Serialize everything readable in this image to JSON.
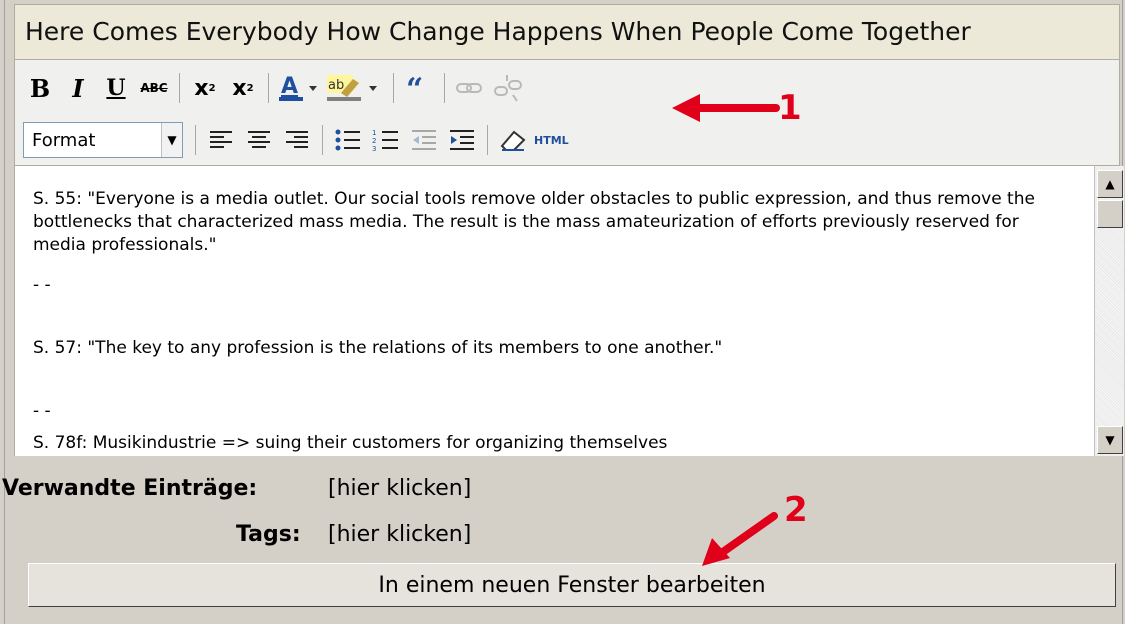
{
  "editor": {
    "title": "Here Comes Everybody How Change Happens When People Come Together",
    "toolbar": {
      "bold": "B",
      "italic": "I",
      "underline": "U",
      "strike": "ABC",
      "subscript": "x",
      "superscript": "x",
      "format_label": "Format",
      "html_label": "HTML"
    },
    "content": [
      "S. 55: \"Everyone is a media outlet. Our social tools remove older obstacles to public expression, and thus remove the bottlenecks that characterized mass media. The result is the mass amateurization of efforts previously reserved for media professionals.\"",
      "- -",
      "S. 57: \"The key to any profession is the relations of its members to one another.\"",
      "- -",
      "S. 78f: Musikindustrie => suing their customers for organizing themselves"
    ]
  },
  "meta": {
    "related_label": "Verwandte Einträge:",
    "related_link": "[hier klicken]",
    "tags_label": "Tags:",
    "tags_link": "[hier klicken]"
  },
  "edit_button": "In einem neuen Fenster bearbeiten",
  "annotations": {
    "one": "1",
    "two": "2",
    "color": "#e0001a"
  }
}
